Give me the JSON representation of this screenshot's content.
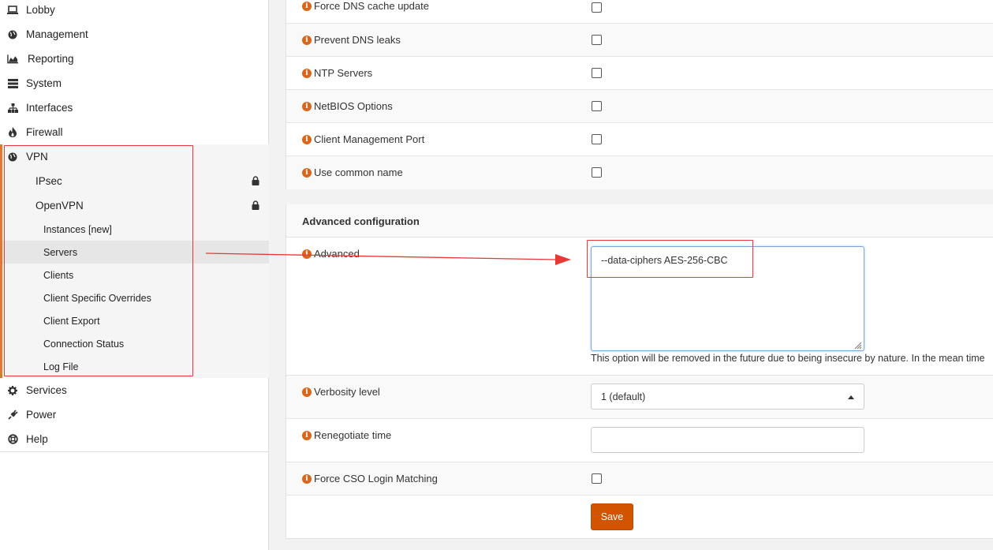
{
  "sidebar": {
    "items": [
      {
        "label": "Lobby",
        "icon": "laptop-icon"
      },
      {
        "label": "Management",
        "icon": "globe-icon"
      },
      {
        "label": "Reporting",
        "icon": "area-chart-icon"
      },
      {
        "label": "System",
        "icon": "server-icon"
      },
      {
        "label": "Interfaces",
        "icon": "sitemap-icon"
      },
      {
        "label": "Firewall",
        "icon": "fire-icon"
      },
      {
        "label": "VPN",
        "icon": "globe-icon"
      }
    ],
    "vpn_children": [
      {
        "label": "IPsec",
        "icon": "lock-icon"
      },
      {
        "label": "OpenVPN",
        "icon": "lock-icon"
      }
    ],
    "openvpn_children": [
      "Instances [new]",
      "Servers",
      "Clients",
      "Client Specific Overrides",
      "Client Export",
      "Connection Status",
      "Log File"
    ],
    "bottom_items": [
      {
        "label": "Services",
        "icon": "gear-icon"
      },
      {
        "label": "Power",
        "icon": "plug-icon"
      },
      {
        "label": "Help",
        "icon": "lifebuoy-icon"
      }
    ]
  },
  "options": [
    {
      "label": "Force DNS cache update"
    },
    {
      "label": "Prevent DNS leaks"
    },
    {
      "label": "NTP Servers"
    },
    {
      "label": "NetBIOS Options"
    },
    {
      "label": "Client Management Port"
    },
    {
      "label": "Use common name"
    }
  ],
  "advanced": {
    "section_title": "Advanced configuration",
    "label": "Advanced",
    "value": "--data-ciphers AES-256-CBC",
    "hint": "This option will be removed in the future due to being insecure by nature. In the mean time"
  },
  "verbosity": {
    "label": "Verbosity level",
    "value": "1 (default)"
  },
  "renegotiate": {
    "label": "Renegotiate time",
    "value": ""
  },
  "force_cso": {
    "label": "Force CSO Login Matching"
  },
  "save_label": "Save",
  "colors": {
    "accent": "#d35400",
    "annotation": "#e53935",
    "info_icon": "#d8661c"
  }
}
